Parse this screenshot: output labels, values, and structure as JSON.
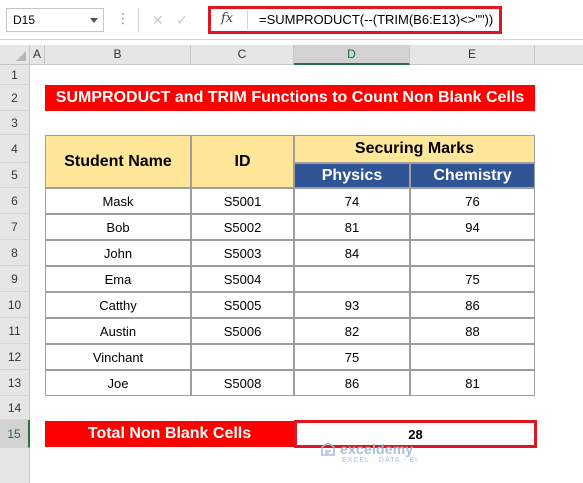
{
  "formula_bar": {
    "cell_ref": "D15",
    "fx_label": "fx",
    "formula": "=SUMPRODUCT(--(TRIM(B6:E13)<>\"\"))",
    "cancel_glyph": "✕",
    "enter_glyph": "✓"
  },
  "columns": [
    "A",
    "B",
    "C",
    "D",
    "E"
  ],
  "rows": [
    "1",
    "2",
    "3",
    "4",
    "5",
    "6",
    "7",
    "8",
    "9",
    "10",
    "11",
    "12",
    "13",
    "14",
    "15"
  ],
  "selected_column": "D",
  "selected_row": "15",
  "sheet": {
    "title": "SUMPRODUCT and TRIM Functions to Count Non Blank Cells",
    "headers": {
      "student_name": "Student Name",
      "id": "ID",
      "securing_marks": "Securing Marks",
      "physics": "Physics",
      "chemistry": "Chemistry"
    },
    "records": [
      {
        "name": "Mask",
        "id": "S5001",
        "physics": "74",
        "chemistry": "76"
      },
      {
        "name": "Bob",
        "id": "S5002",
        "physics": "81",
        "chemistry": "94"
      },
      {
        "name": "John",
        "id": "S5003",
        "physics": "84",
        "chemistry": ""
      },
      {
        "name": "Ema",
        "id": "S5004",
        "physics": "",
        "chemistry": "75"
      },
      {
        "name": "Catthy",
        "id": "S5005",
        "physics": "93",
        "chemistry": "86"
      },
      {
        "name": "Austin",
        "id": "S5006",
        "physics": "82",
        "chemistry": "88"
      },
      {
        "name": "Vinchant",
        "id": "",
        "physics": "75",
        "chemistry": ""
      },
      {
        "name": "Joe",
        "id": "S5008",
        "physics": "86",
        "chemistry": "81"
      }
    ],
    "total_label": "Total Non Blank Cells",
    "total_value": "28"
  },
  "watermark": {
    "name": "exceldemy",
    "tagline": "EXCEL · DATA · BI"
  },
  "colors": {
    "title_red": "#ff0000",
    "header_yellow": "#ffe699",
    "header_blue": "#2f5597",
    "highlight_border": "#e0151f",
    "excel_green": "#217346"
  }
}
